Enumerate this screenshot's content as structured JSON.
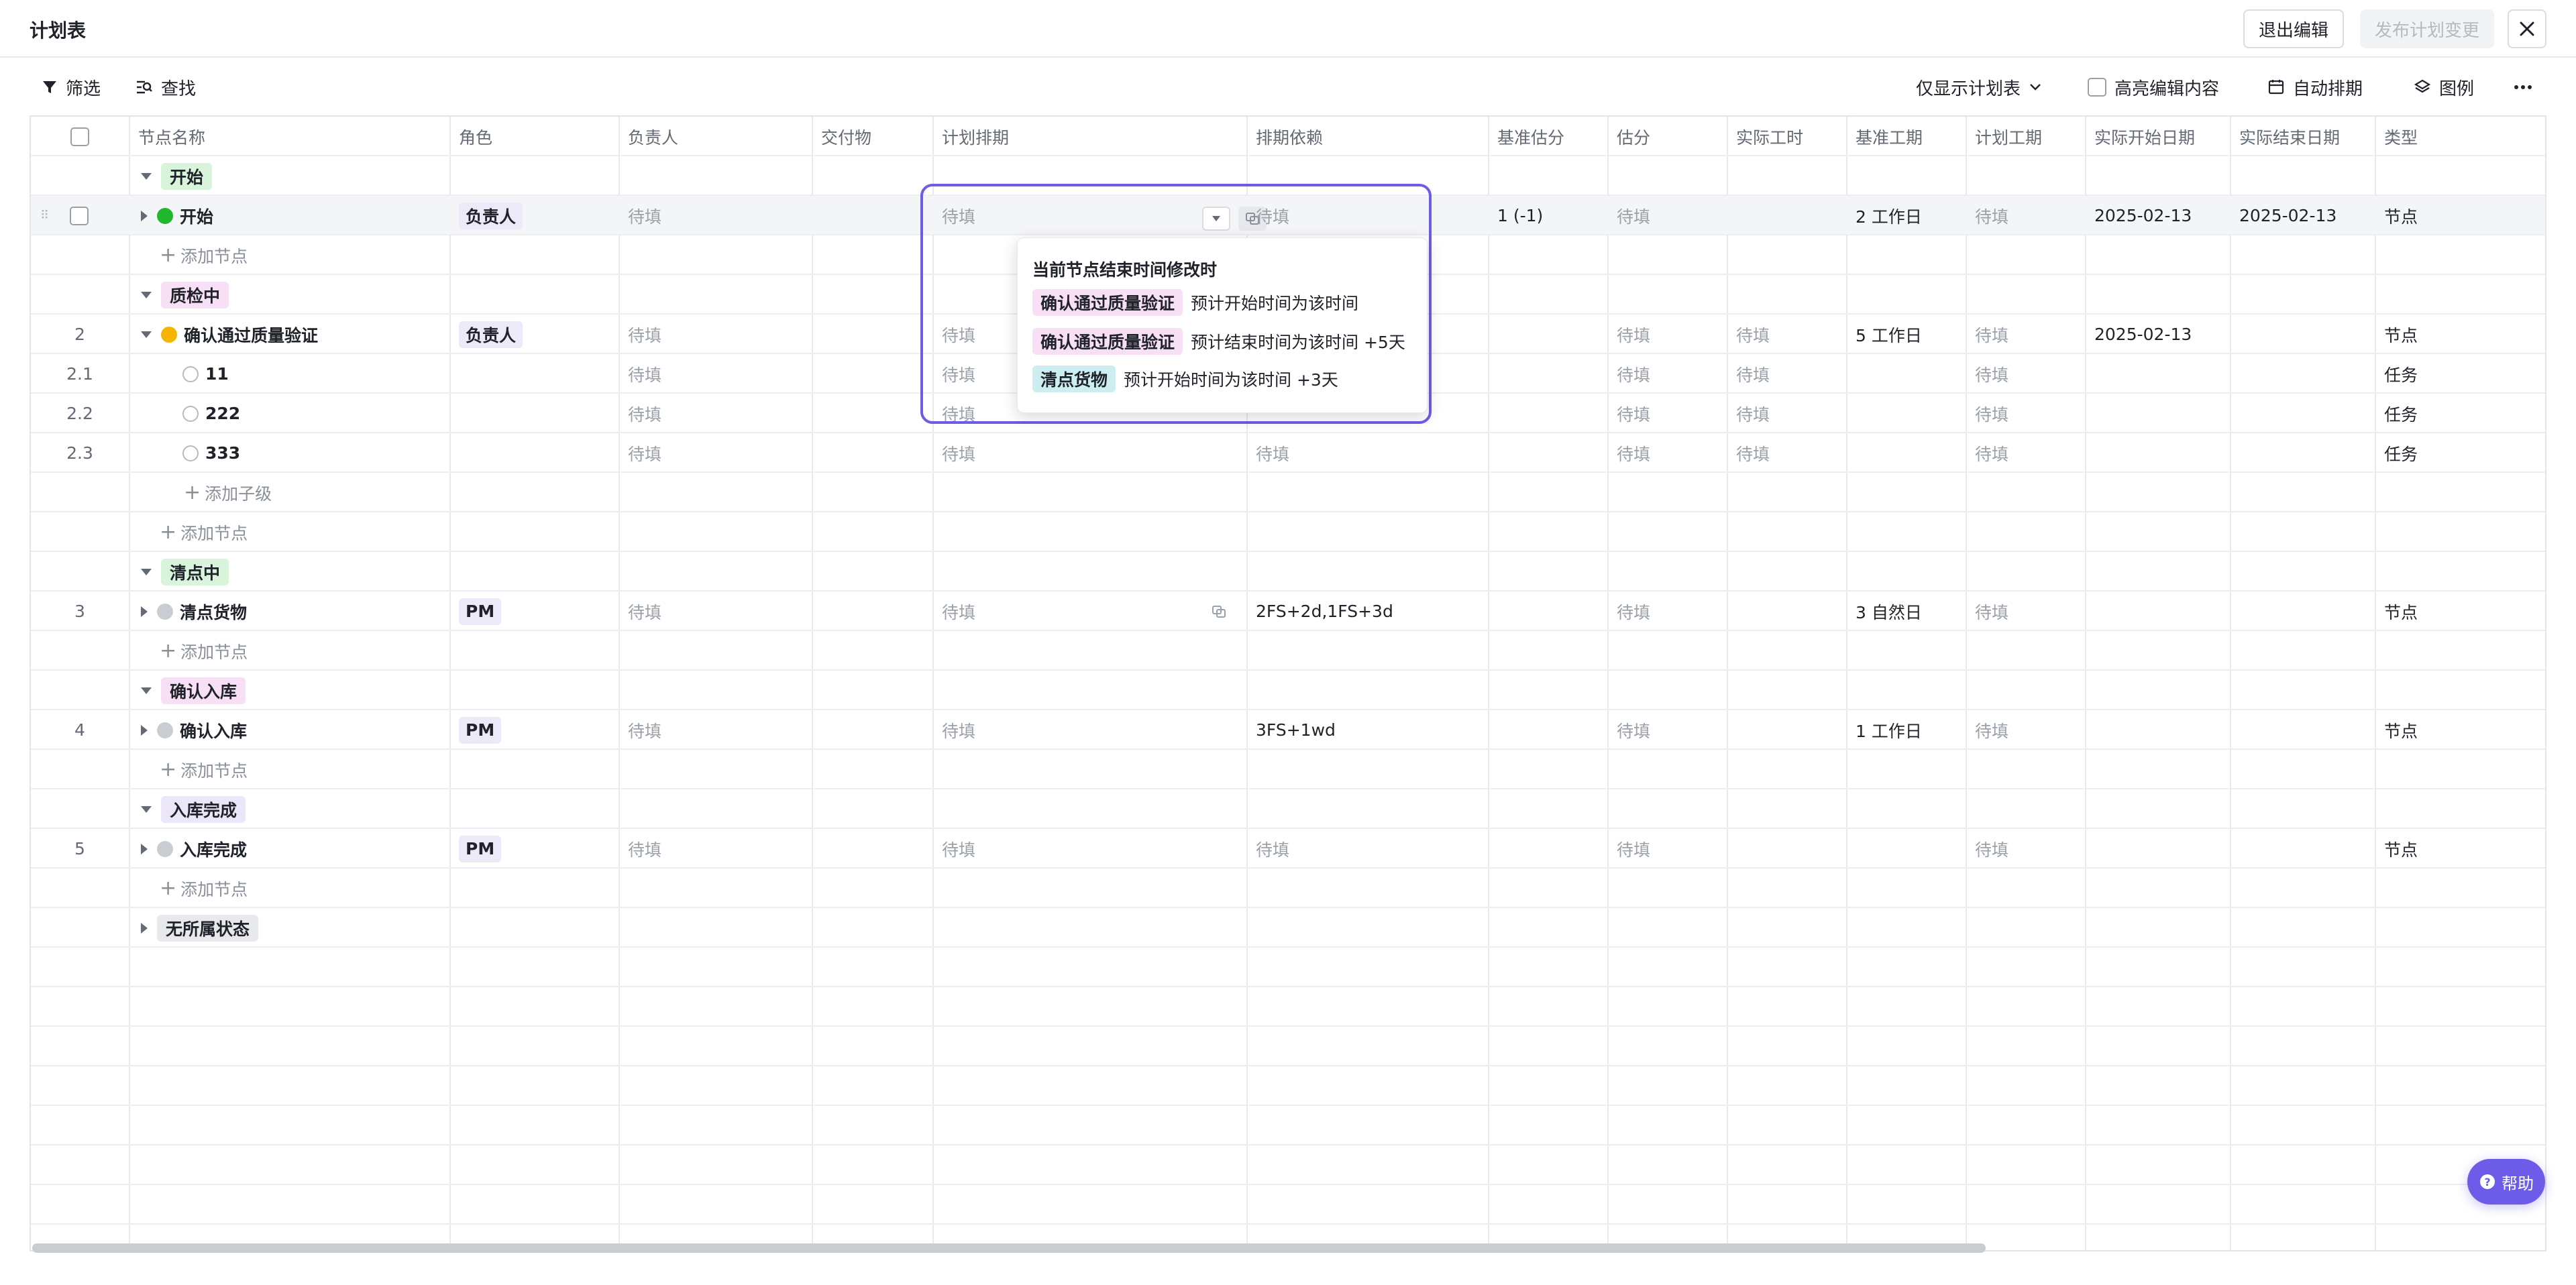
{
  "header": {
    "title": "计划表",
    "exit_edit_label": "退出编辑",
    "publish_label": "发布计划变更"
  },
  "toolbar": {
    "filter_label": "筛选",
    "find_label": "查找",
    "view_select_label": "仅显示计划表",
    "highlight_label": "高亮编辑内容",
    "auto_schedule_label": "自动排期",
    "legend_label": "图例"
  },
  "columns": [
    "节点名称",
    "角色",
    "负责人",
    "交付物",
    "计划排期",
    "排期依赖",
    "基准估分",
    "估分",
    "实际工时",
    "基准工期",
    "计划工期",
    "实际开始日期",
    "实际结束日期",
    "类型"
  ],
  "rows": {
    "g1": {
      "label": "开始"
    },
    "r1": {
      "name": "开始",
      "role": "负责人",
      "owner": "待填",
      "plan": "待填",
      "dep": "待填",
      "base_est": "1 (-1)",
      "est": "待填",
      "base_dur": "2 工作日",
      "plan_dur": "待填",
      "start": "2025-02-13",
      "end": "2025-02-13",
      "type": "节点"
    },
    "add1": "添加节点",
    "g2": {
      "label": "质检中"
    },
    "r2": {
      "num": "2",
      "name": "确认通过质量验证",
      "role": "负责人",
      "owner": "待填",
      "plan": "待填",
      "est": "待填",
      "hours": "待填",
      "base_dur": "5 工作日",
      "plan_dur": "待填",
      "start": "2025-02-13",
      "type": "节点"
    },
    "r21": {
      "num": "2.1",
      "name": "11",
      "owner": "待填",
      "plan": "待填",
      "est": "待填",
      "hours": "待填",
      "plan_dur": "待填",
      "type": "任务"
    },
    "r22": {
      "num": "2.2",
      "name": "222",
      "owner": "待填",
      "plan": "待填",
      "dep": "待填",
      "est": "待填",
      "hours": "待填",
      "plan_dur": "待填",
      "type": "任务"
    },
    "r23": {
      "num": "2.3",
      "name": "333",
      "owner": "待填",
      "plan": "待填",
      "dep": "待填",
      "est": "待填",
      "hours": "待填",
      "plan_dur": "待填",
      "type": "任务"
    },
    "addsub": "添加子级",
    "add2": "添加节点",
    "g3": {
      "label": "清点中"
    },
    "r3": {
      "num": "3",
      "name": "清点货物",
      "role": "PM",
      "owner": "待填",
      "plan": "待填",
      "dep": "2FS+2d,1FS+3d",
      "est": "待填",
      "base_dur": "3 自然日",
      "plan_dur": "待填",
      "type": "节点"
    },
    "add3": "添加节点",
    "g4": {
      "label": "确认入库"
    },
    "r4": {
      "num": "4",
      "name": "确认入库",
      "role": "PM",
      "owner": "待填",
      "plan": "待填",
      "dep": "3FS+1wd",
      "est": "待填",
      "base_dur": "1 工作日",
      "plan_dur": "待填",
      "type": "节点"
    },
    "add4": "添加节点",
    "g5": {
      "label": "入库完成"
    },
    "r5": {
      "num": "5",
      "name": "入库完成",
      "role": "PM",
      "owner": "待填",
      "plan": "待填",
      "dep": "待填",
      "est": "待填",
      "plan_dur": "待填",
      "type": "节点"
    },
    "add5": "添加节点",
    "g6": {
      "label": "无所属状态"
    }
  },
  "popup": {
    "title": "当前节点结束时间修改时",
    "items": [
      {
        "tag": "确认通过质量验证",
        "text": "预计开始时间为该时间"
      },
      {
        "tag": "确认通过质量验证",
        "text": "预计结束时间为该时间 +5天"
      },
      {
        "tag": "清点货物",
        "text": "预计开始时间为该时间 +3天"
      }
    ]
  },
  "help_label": "帮助",
  "colors": {
    "accent": "#6c5ce7",
    "status_green": "#1fb82c",
    "status_yellow": "#f5b400",
    "status_gray": "#c9ccd1"
  }
}
